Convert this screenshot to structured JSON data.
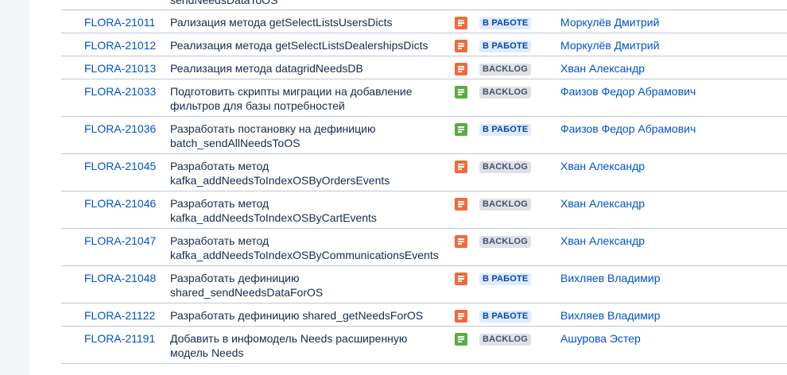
{
  "top_row_fragment": "sendNeedsDataToOS",
  "issues": [
    {
      "key": "FLORA-21011",
      "summary": "Рализация метода getSelectListsUsersDicts",
      "type_icon": "subtask-orange-icon",
      "status": "В РАБОТЕ",
      "assignee": "Моркулёв Дмитрий"
    },
    {
      "key": "FLORA-21012",
      "summary": "Реализация метода getSelectListsDealershipsDicts",
      "type_icon": "subtask-orange-icon",
      "status": "В РАБОТЕ",
      "assignee": "Моркулёв Дмитрий"
    },
    {
      "key": "FLORA-21013",
      "summary": "Реализация метода datagridNeedsDB",
      "type_icon": "subtask-orange-icon",
      "status": "BACKLOG",
      "assignee": "Хван Александр"
    },
    {
      "key": "FLORA-21033",
      "summary_line1": "Подготовить скрипты миграции на добавление",
      "summary_line2": "фильтров для базы потребностей",
      "type_icon": "subtask-green-icon",
      "status": "BACKLOG",
      "assignee": "Фаизов Федор Абрамович"
    },
    {
      "key": "FLORA-21036",
      "summary_line1": "Разработать постановку на дефиницию",
      "summary_line2": "batch_sendAllNeedsToOS",
      "type_icon": "subtask-green-icon",
      "status": "В РАБОТЕ",
      "assignee": "Фаизов Федор Абрамович"
    },
    {
      "key": "FLORA-21045",
      "summary_line1": "Разработать метод",
      "summary_line2": "kafka_addNeedsToIndexOSByOrdersEvents",
      "type_icon": "subtask-orange-icon",
      "status": "BACKLOG",
      "assignee": "Хван Александр"
    },
    {
      "key": "FLORA-21046",
      "summary_line1": "Разработать метод",
      "summary_line2": "kafka_addNeedsToIndexOSByCartEvents",
      "type_icon": "subtask-orange-icon",
      "status": "BACKLOG",
      "assignee": "Хван Александр"
    },
    {
      "key": "FLORA-21047",
      "summary_line1": "Разработать метод",
      "summary_line2": "kafka_addNeedsToIndexOSByCommunicationsEvents",
      "type_icon": "subtask-orange-icon",
      "status": "BACKLOG",
      "assignee": "Хван Александр"
    },
    {
      "key": "FLORA-21048",
      "summary_line1": "Разработать дефиницию",
      "summary_line2": "shared_sendNeedsDataForOS",
      "type_icon": "subtask-orange-icon",
      "status": "В РАБОТЕ",
      "assignee": "Вихляев Владимир"
    },
    {
      "key": "FLORA-21122",
      "summary": "Разработать дефиницию shared_getNeedsForOS",
      "type_icon": "subtask-orange-icon",
      "status": "В РАБОТЕ",
      "assignee": "Вихляев Владимир"
    },
    {
      "key": "FLORA-21191",
      "summary_line1": "Добавить в инфомодель Needs расширенную",
      "summary_line2": "модель Needs",
      "type_icon": "subtask-green-icon",
      "status": "BACKLOG",
      "assignee": "Ашурова Эстер"
    }
  ]
}
